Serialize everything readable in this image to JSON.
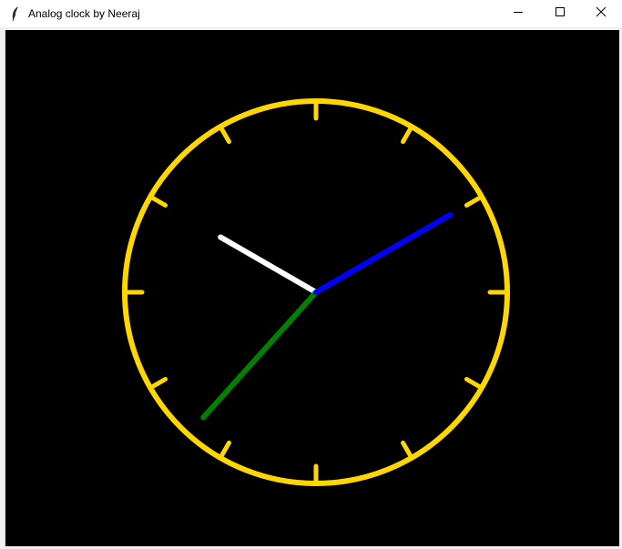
{
  "window": {
    "title": "Analog clock by Neeraj",
    "app_icon": "feather-icon",
    "controls": [
      "minimize-icon",
      "maximize-icon",
      "close-icon"
    ]
  },
  "clock": {
    "background": "#000000",
    "dial_color": "#ffd700",
    "tick_count": 12,
    "hands": {
      "hour": {
        "color": "#ffffff",
        "angle_deg": 300
      },
      "minute": {
        "color": "#008000",
        "angle_deg": 222
      },
      "second": {
        "color": "#0000ff",
        "angle_deg": 60
      }
    }
  }
}
